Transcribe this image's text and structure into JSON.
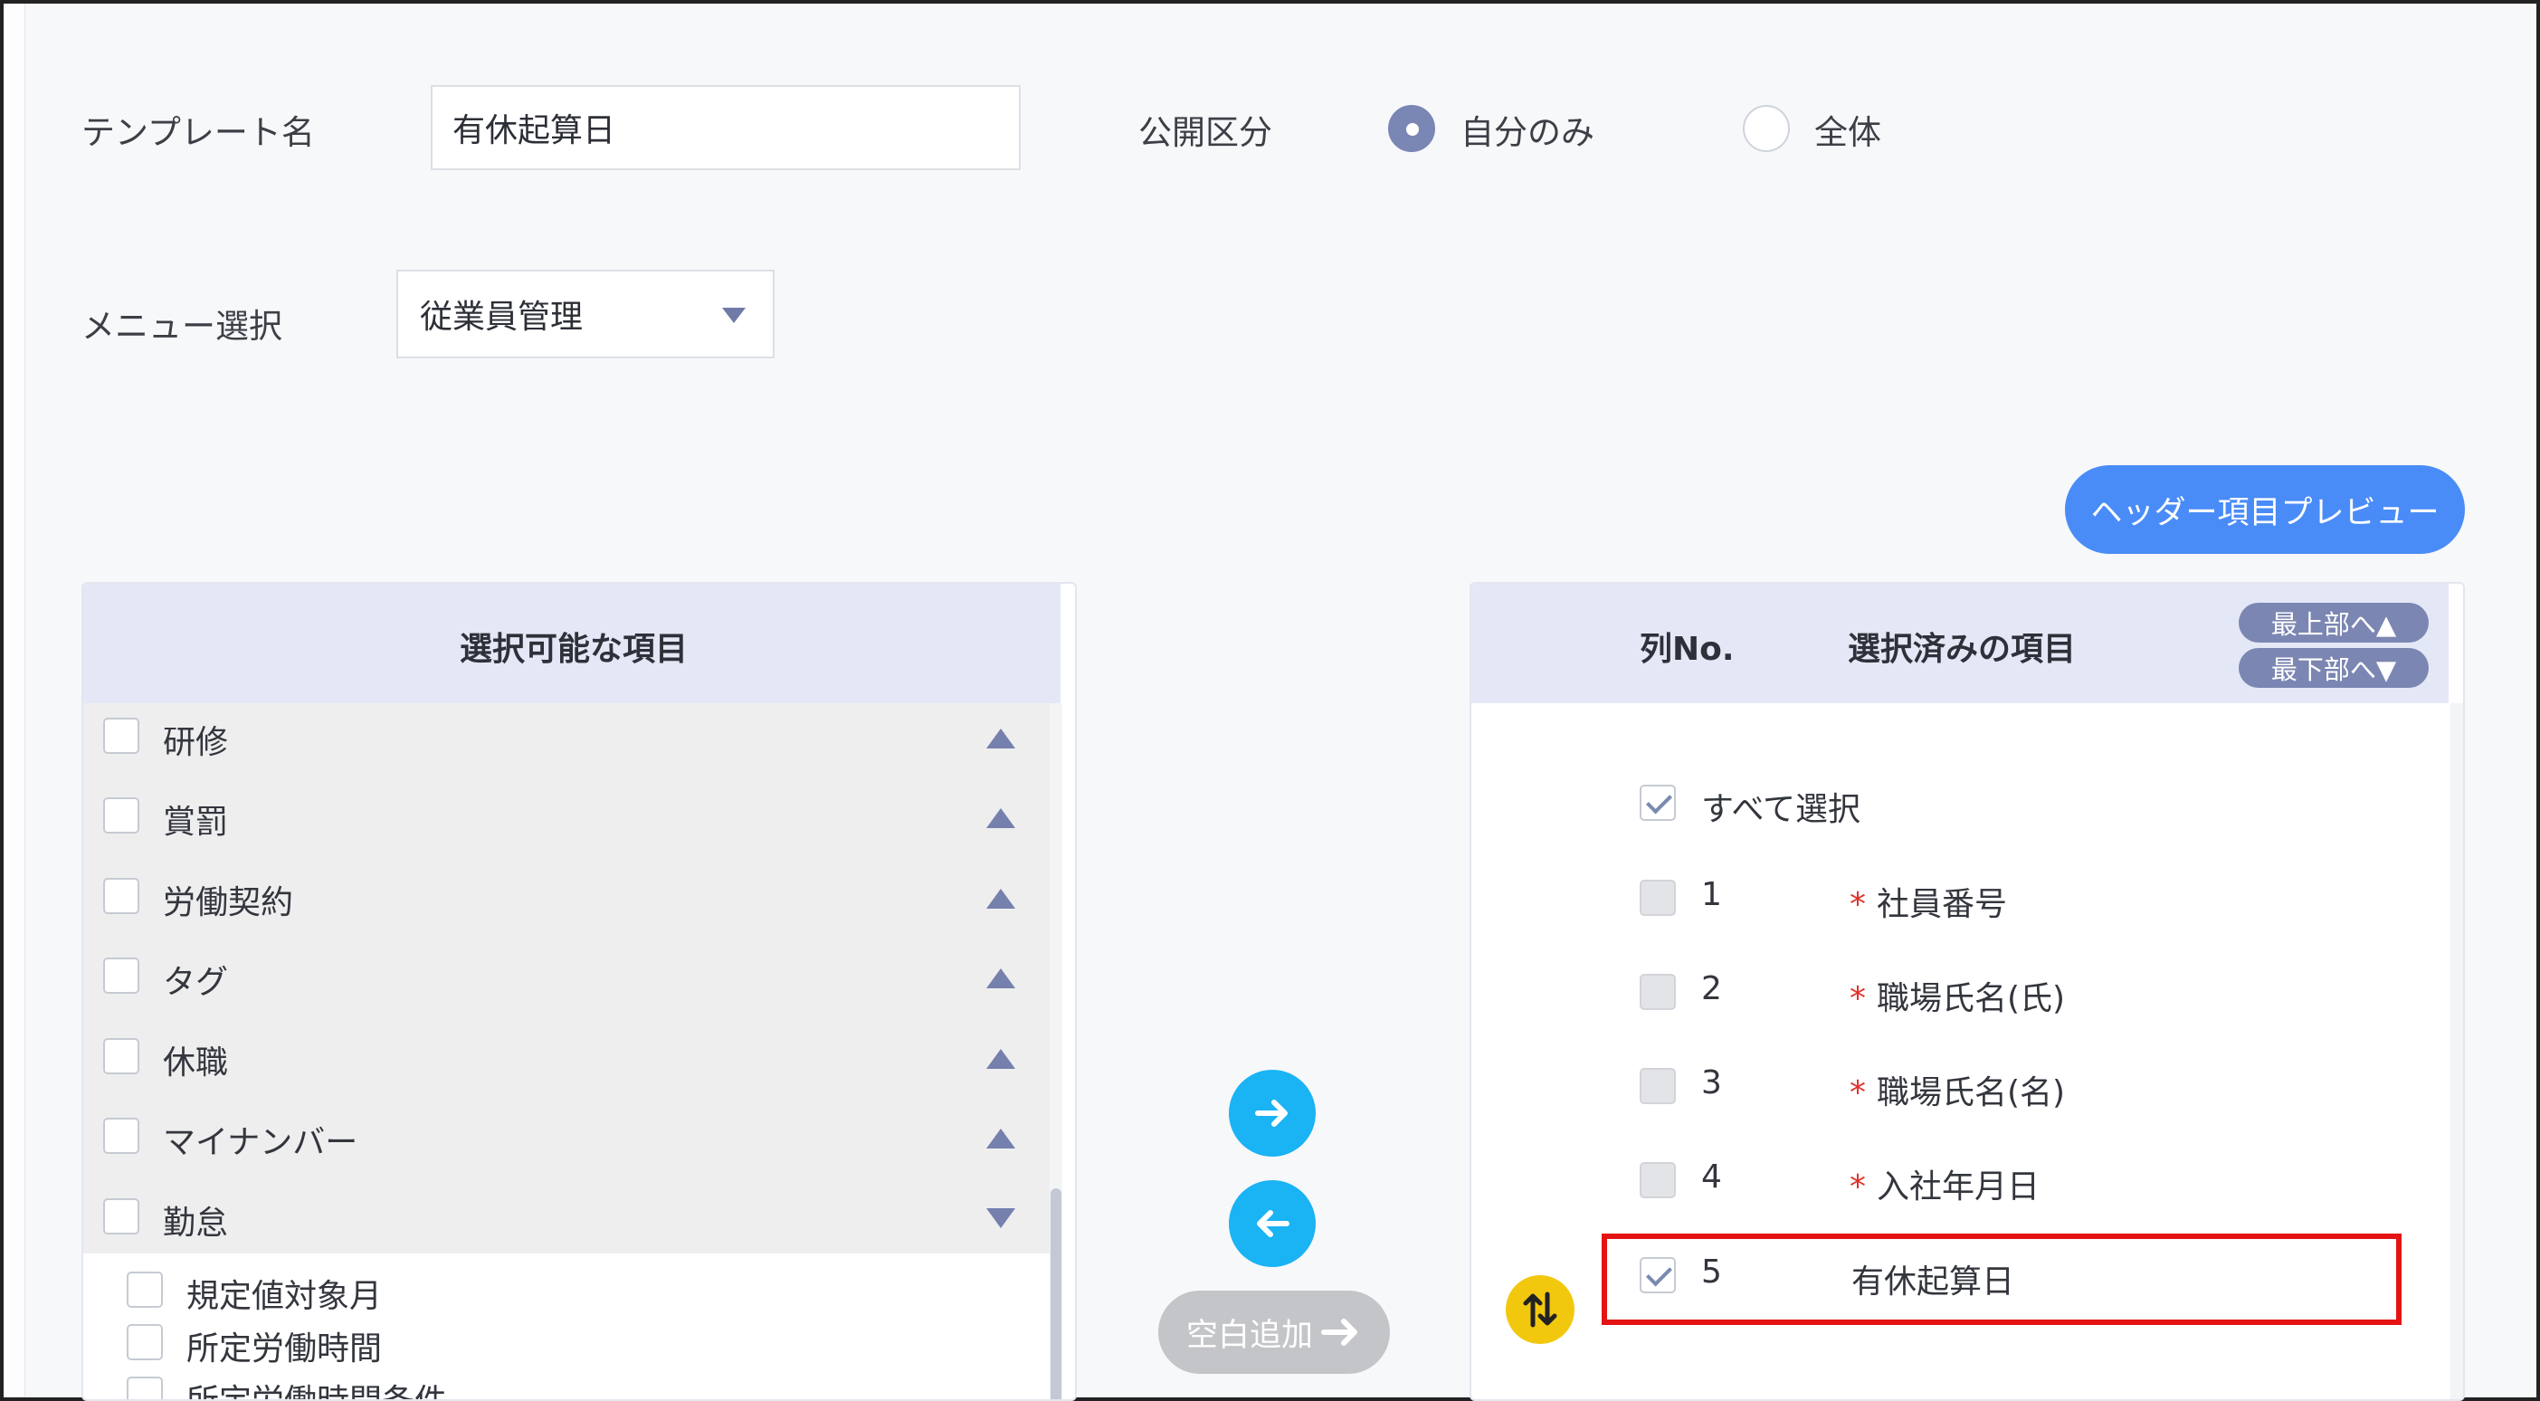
{
  "form": {
    "template_name_label": "テンプレート名",
    "template_name_value": "有休起算日",
    "visibility_label": "公開区分",
    "visibility_options": [
      "自分のみ",
      "全体"
    ],
    "visibility_selected": "自分のみ",
    "menu_label": "メニュー選択",
    "menu_value": "従業員管理"
  },
  "header_preview_button": "ヘッダー項目プレビュー",
  "available_panel": {
    "title": "選択可能な項目",
    "groups": [
      {
        "label": "研修",
        "expanded": false
      },
      {
        "label": "賞罰",
        "expanded": false
      },
      {
        "label": "労働契約",
        "expanded": false
      },
      {
        "label": "タグ",
        "expanded": false
      },
      {
        "label": "休職",
        "expanded": false
      },
      {
        "label": "マイナンバー",
        "expanded": false
      },
      {
        "label": "勤怠",
        "expanded": true
      }
    ],
    "sub_items": [
      "規定値対象月",
      "所定労働時間",
      "所定労働時間条件"
    ]
  },
  "transfer": {
    "add_blank_label": "空白追加"
  },
  "selected_panel": {
    "col_no_header": "列No.",
    "items_header": "選択済みの項目",
    "move_top_label": "最上部へ▲",
    "move_bottom_label": "最下部へ▼",
    "select_all_label": "すべて選択",
    "rows": [
      {
        "no": "1",
        "label": "社員番号",
        "required": true,
        "checked": false
      },
      {
        "no": "2",
        "label": "職場氏名(氏)",
        "required": true,
        "checked": false
      },
      {
        "no": "3",
        "label": "職場氏名(名)",
        "required": true,
        "checked": false
      },
      {
        "no": "4",
        "label": "入社年月日",
        "required": true,
        "checked": false
      },
      {
        "no": "5",
        "label": "有休起算日",
        "required": false,
        "checked": true
      }
    ],
    "required_mark": "*"
  },
  "colors": {
    "accent_blue": "#4a8cf7",
    "arrow_button": "#1ab3f4",
    "header_bg": "#e4e8f6",
    "highlight_border": "#e41414",
    "drag_handle": "#f2c80f"
  }
}
